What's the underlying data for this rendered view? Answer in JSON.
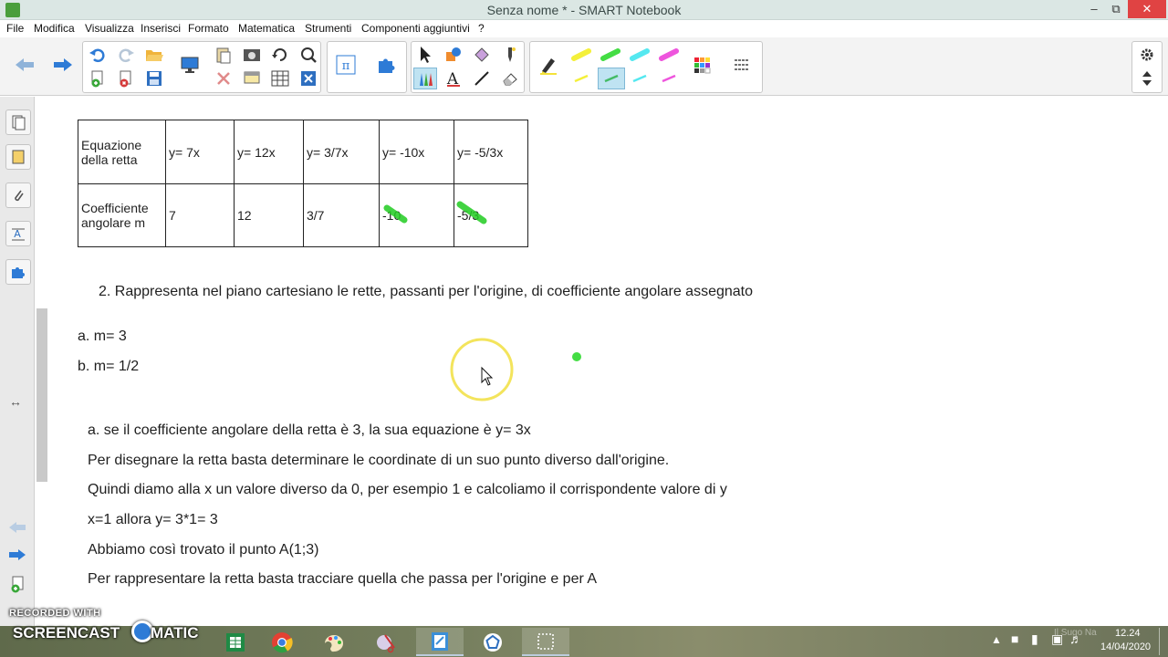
{
  "window": {
    "title": "Senza nome * - SMART Notebook"
  },
  "menu": [
    "File",
    "Modifica",
    "Visualizza",
    "Inserisci",
    "Formato",
    "Matematica",
    "Strumenti",
    "Componenti aggiuntivi",
    "?"
  ],
  "table": {
    "rows": [
      [
        "Equazione della retta",
        "y= 7x",
        "y= 12x",
        "y= 3/7x",
        "y= -10x",
        "y= -5/3x"
      ],
      [
        "Coefficiente angolare m",
        "7",
        "12",
        "3/7",
        "-10",
        "-5/3"
      ]
    ]
  },
  "content": {
    "task2": "2. Rappresenta nel piano cartesiano le rette, passanti per l'origine, di coefficiente angolare assegnato",
    "item_a": "a. m= 3",
    "item_b": "b. m= 1/2",
    "lines": [
      "a. se il coefficiente angolare della retta è 3, la sua equazione è y= 3x",
      "Per disegnare la retta basta determinare le coordinate di un suo punto diverso dall'origine.",
      "Quindi diamo alla x un valore diverso da 0, per esempio 1 e calcoliamo il corrispondente valore di y",
      "x=1 allora y= 3*1= 3",
      "Abbiamo così trovato il punto A(1;3)",
      "Per rappresentare la retta basta tracciare quella che passa per l'origine e per A"
    ]
  },
  "colors": {
    "highlight": "#22cc22",
    "cursor_ring": "#f2e14a",
    "accent": "#2e7bd6"
  },
  "watermark": {
    "top": "RECORDED WITH",
    "brand_left": "SCREENCAST",
    "brand_right": "MATIC"
  },
  "taskbar": {
    "clock_time": "12.24",
    "clock_date": "14/04/2020",
    "faded_text": "Il Sugo Na"
  },
  "icons": [
    "back-arrow-icon",
    "forward-arrow-icon",
    "undo-icon",
    "redo-icon",
    "open-folder-icon",
    "add-page-icon",
    "delete-page-icon",
    "save-icon",
    "display-icon",
    "paste-icon",
    "screen-capture-icon",
    "pi-icon",
    "puzzle-icon",
    "select-arrow-icon",
    "pens-icon",
    "text-icon",
    "line-icon",
    "eraser-icon",
    "highlighter-icon",
    "settings-icon"
  ]
}
